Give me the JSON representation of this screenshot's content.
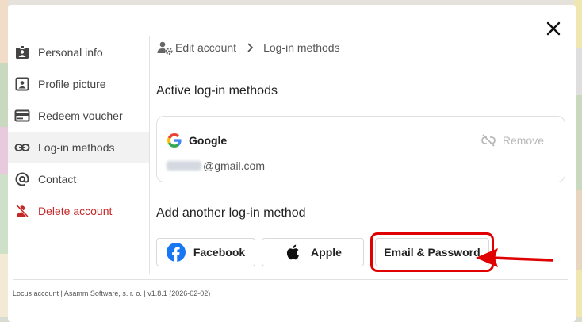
{
  "colors": {
    "accent_red": "#e00000",
    "danger": "#c62828",
    "disabled": "#b9b9b9"
  },
  "sidebar": {
    "items": [
      {
        "label": "Personal info",
        "icon": "id-badge-icon"
      },
      {
        "label": "Profile picture",
        "icon": "portrait-icon"
      },
      {
        "label": "Redeem voucher",
        "icon": "voucher-icon"
      },
      {
        "label": "Log-in methods",
        "icon": "link-icon",
        "active": true
      },
      {
        "label": "Contact",
        "icon": "at-icon"
      },
      {
        "label": "Delete account",
        "icon": "person-remove-icon",
        "danger": true
      }
    ]
  },
  "breadcrumb": {
    "parent": "Edit account",
    "current": "Log-in methods"
  },
  "active_section": {
    "title": "Active log-in methods",
    "method": {
      "provider": "Google",
      "email_suffix": "@gmail.com",
      "remove_label": "Remove"
    }
  },
  "add_section": {
    "title": "Add another log-in method",
    "options": {
      "facebook": "Facebook",
      "apple": "Apple",
      "email": "Email & Password"
    }
  },
  "footer": {
    "text": "Locus account | Asamm Software, s. r. o. | v1.8.1 (2026-02-02)"
  }
}
